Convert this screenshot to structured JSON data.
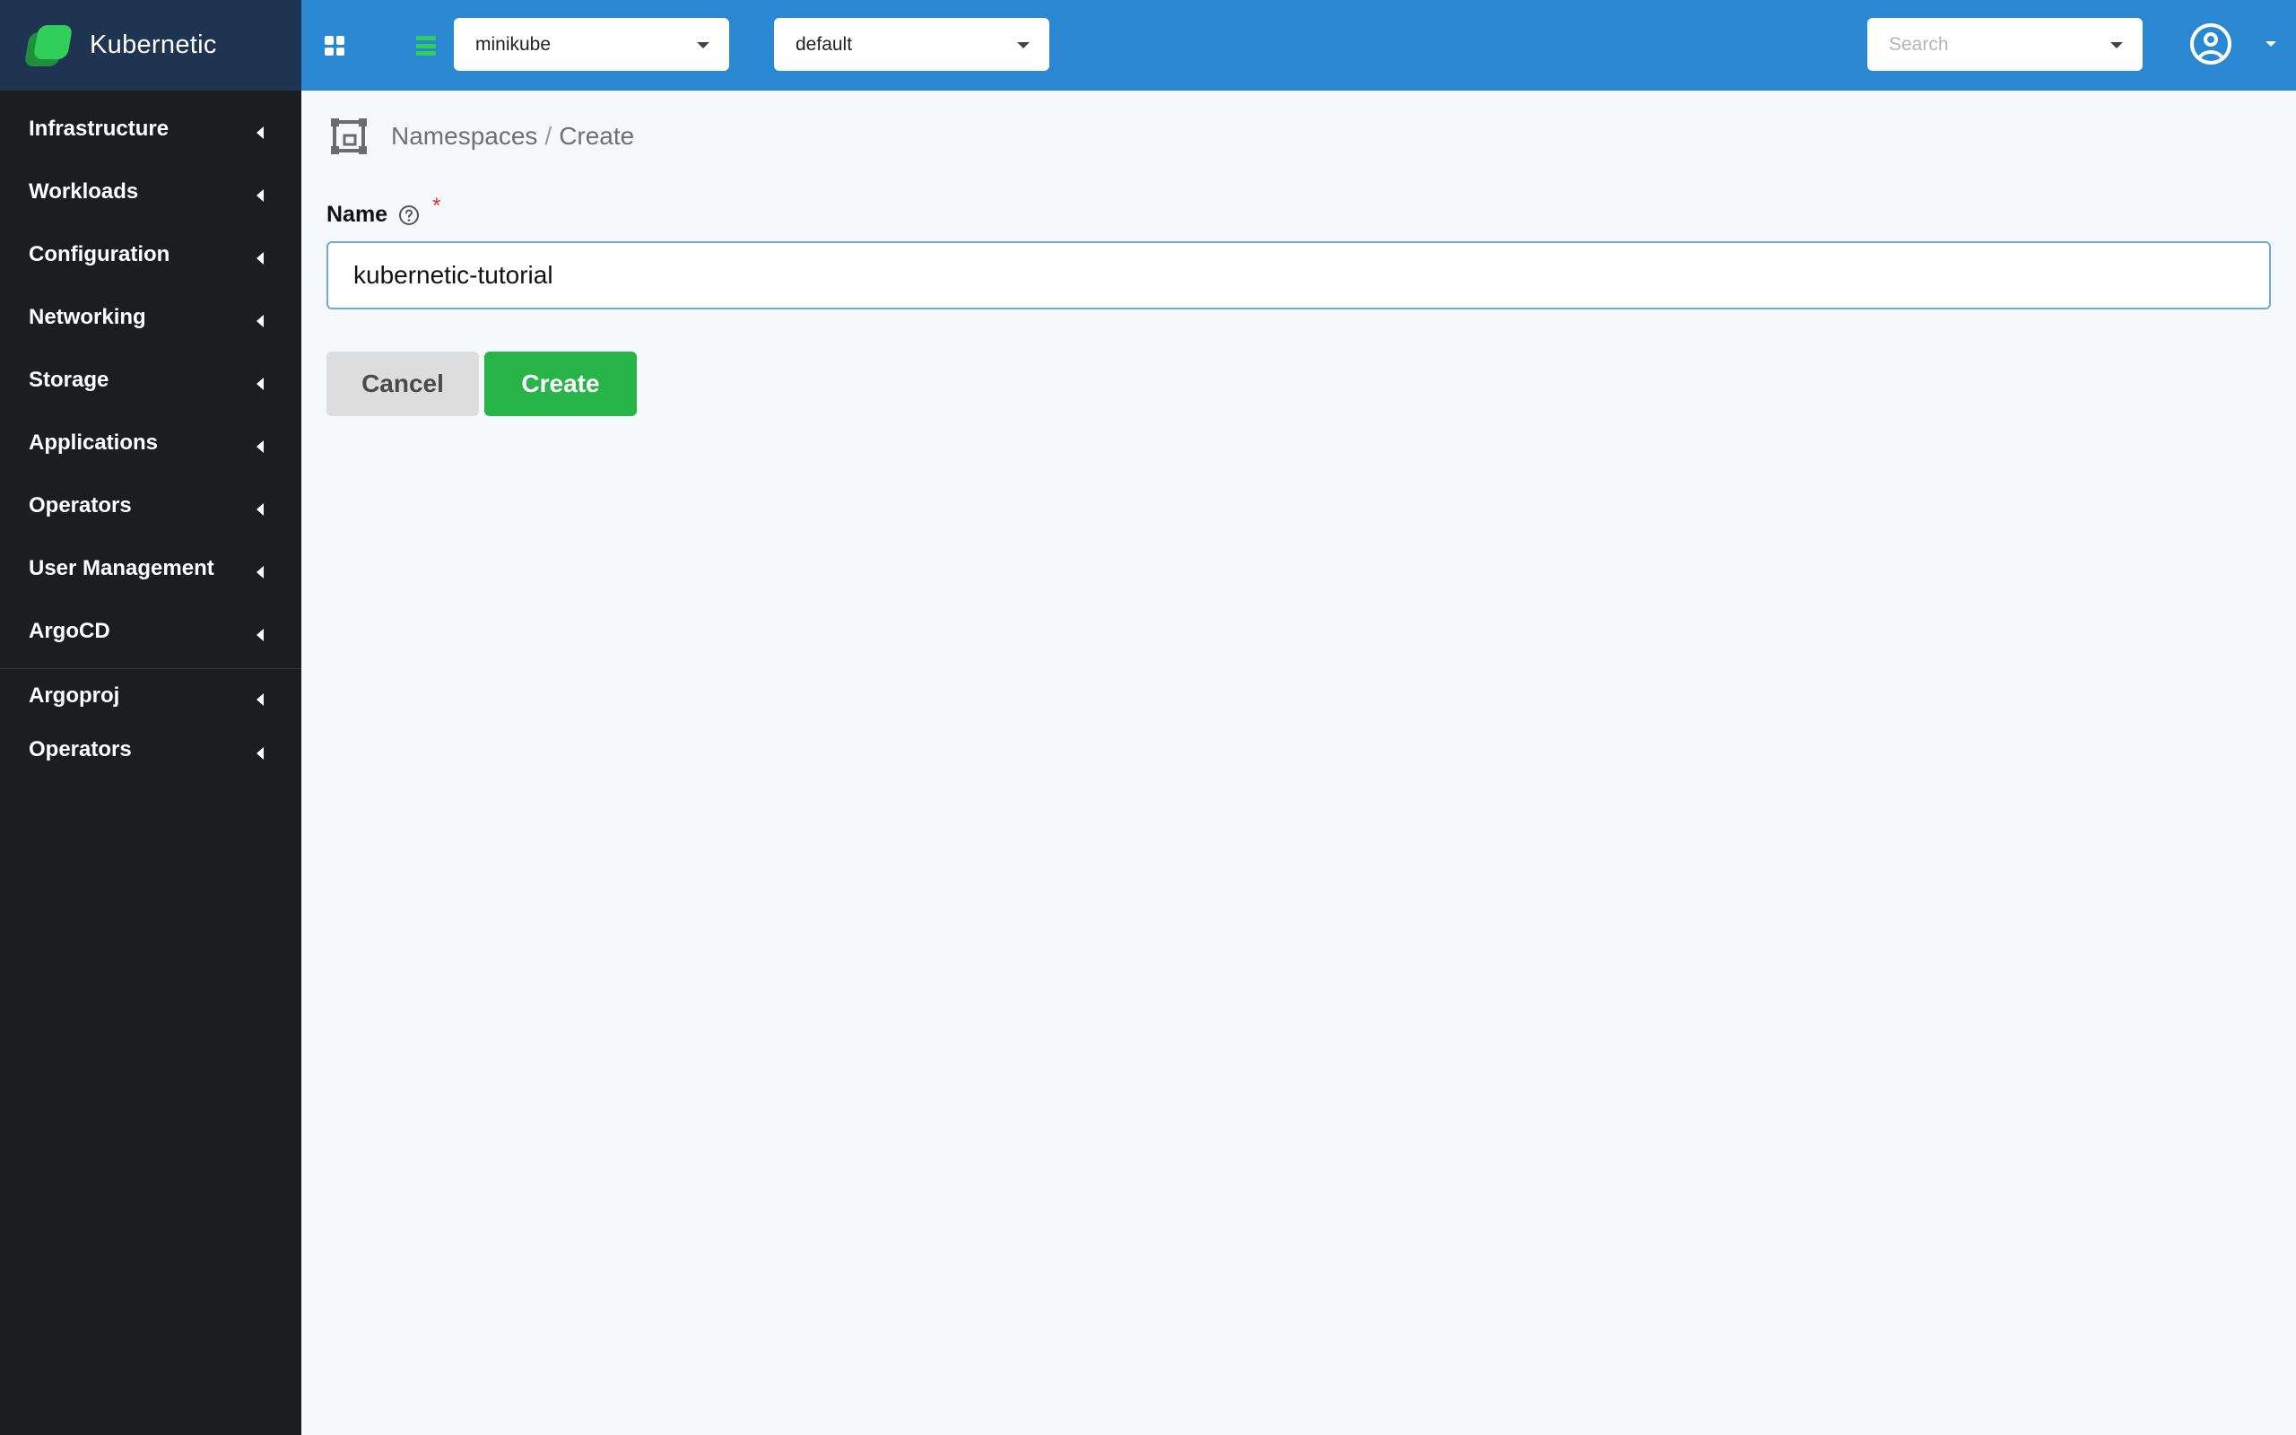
{
  "brand": {
    "name": "Kubernetic"
  },
  "sidebar": {
    "items": [
      {
        "label": "Infrastructure"
      },
      {
        "label": "Workloads"
      },
      {
        "label": "Configuration"
      },
      {
        "label": "Networking"
      },
      {
        "label": "Storage"
      },
      {
        "label": "Applications"
      },
      {
        "label": "Operators"
      },
      {
        "label": "User Management"
      },
      {
        "label": "ArgoCD"
      }
    ],
    "custom_items": [
      {
        "label": "Argoproj"
      },
      {
        "label": "Operators"
      }
    ]
  },
  "topbar": {
    "cluster_value": "minikube",
    "namespace_value": "default",
    "search_placeholder": "Search"
  },
  "breadcrumb": {
    "section": "Namespaces",
    "separator": "/",
    "page": "Create"
  },
  "form": {
    "name_label": "Name",
    "required_mark": "*",
    "name_value": "kubernetic-tutorial",
    "cancel_label": "Cancel",
    "create_label": "Create"
  },
  "colors": {
    "sidebar_bg": "#1b1d1f",
    "brand_bg": "#1e3450",
    "topbar_bg": "#2a88d2",
    "create_button": "#27b54a",
    "cancel_button": "#dddddd",
    "main_bg": "#f5f9fc"
  },
  "icons": {
    "logo": "kubernetic-logo",
    "dashboard": "grid-icon",
    "list": "list-icon",
    "namespace": "namespace-icon",
    "help": "question-circle-icon",
    "user": "user-circle-icon"
  }
}
